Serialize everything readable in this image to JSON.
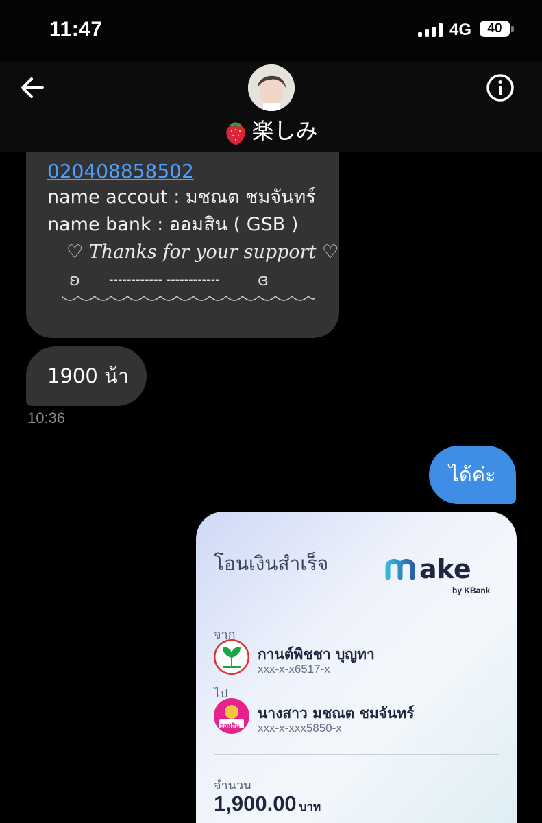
{
  "status_bar": {
    "time": "11:47",
    "network": "4G",
    "battery": "40"
  },
  "header": {
    "chat_name": "楽しみ",
    "icons": {
      "back": "arrow-left-icon",
      "info": "info-icon",
      "name_emoji": "strawberry-icon"
    }
  },
  "messages": {
    "account_number": "020408858502",
    "name_account_line": "name accout : มชณต ชมจันทร์",
    "name_bank_line": "name bank : ออมสิน ( GSB )",
    "thanks_line": "♡ Thanks for your support ♡",
    "deco_left": "ʚ",
    "deco_dashes": "------------ ------------",
    "deco_right": "ɞ",
    "amount_message": "1900 น้า",
    "timestamp": "10:36",
    "reply": "ได้ค่ะ"
  },
  "receipt": {
    "title": "โอนเงินสำเร็จ",
    "logo_text": "make",
    "logo_sub": "by KBank",
    "from_label": "จาก",
    "from_name": "กานต์พิชชา บุญทา",
    "from_account": "xxx-x-x6517-x",
    "to_label": "ไป",
    "to_name": "นางสาว มชณต ชมจันทร์",
    "to_account": "xxx-x-xxx5850-x",
    "to_bank_short": "ออมสิน",
    "amount_label": "จำนวน",
    "amount": "1,900.00",
    "currency": "บาท"
  },
  "colors": {
    "incoming_bubble": "#333336",
    "outgoing_bubble": "#3f8ee6",
    "link": "#4ea1ff",
    "kbank_green": "#1ba54b",
    "gsb_pink": "#e8228c"
  }
}
